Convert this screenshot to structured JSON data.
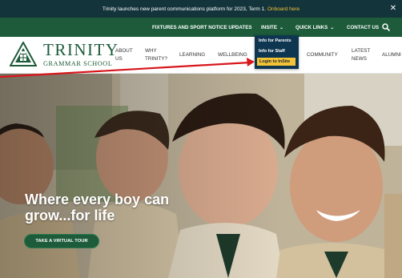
{
  "announcement": {
    "text": "Trinity launches new parent communications platform for 2023, Term 1.",
    "cta": "Onboard here",
    "close_glyph": "✕"
  },
  "utility_nav": {
    "fixtures": "FIXTURES AND SPORT NOTICE UPDATES",
    "insite": "INSITE",
    "quick_links": "QUICK LINKS",
    "contact": "CONTACT US",
    "caret_glyph": "⌄",
    "search_icon": "search-icon"
  },
  "insite_dropdown": {
    "items": [
      "Info for Parents",
      "Info for Staff",
      "Login to InSite"
    ],
    "highlighted": "Login to InSite"
  },
  "logo": {
    "title": "TRINITY",
    "subtitle": "GRAMMAR SCHOOL"
  },
  "main_nav": {
    "items": [
      "ABOUT US",
      "WHY TRINITY?",
      "LEARNING",
      "WELLBEING",
      "COMMUNITY",
      "LATEST NEWS",
      "ALUMNI"
    ]
  },
  "hero": {
    "headline": "Where every boy can grow...for life",
    "button": "TAKE A VIRTUAL TOUR"
  },
  "colors": {
    "announcement_bg": "#14343c",
    "brand_green": "#1d5b3a",
    "dropdown_bg": "#0f3650",
    "highlight_yellow": "#f3c335",
    "cta_yellow": "#f1c232",
    "annotation_red": "#d8161c"
  }
}
